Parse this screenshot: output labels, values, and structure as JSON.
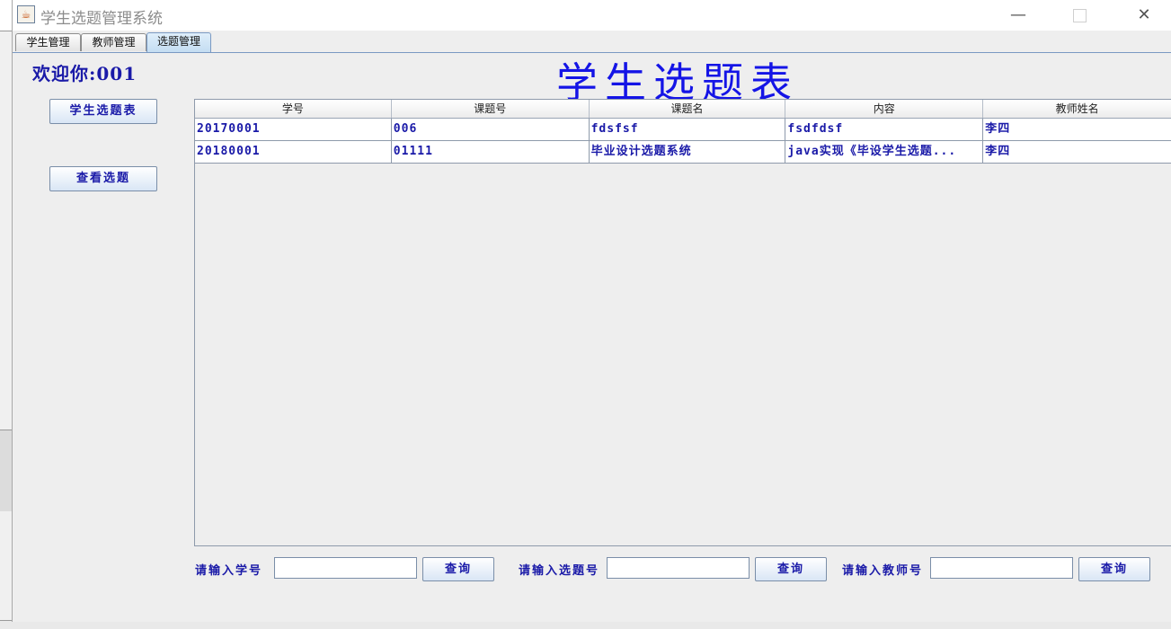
{
  "window": {
    "title": "学生选题管理系统"
  },
  "tabs": [
    {
      "label": "学生管理"
    },
    {
      "label": "教师管理"
    },
    {
      "label": "选题管理"
    }
  ],
  "active_tab": "选题管理",
  "welcome_text": "欢迎你:001",
  "page_title": "学生选题表",
  "sidebar": {
    "student_selection_button": "学生选题表",
    "view_topics_button": "查看选题"
  },
  "table": {
    "columns": [
      "学号",
      "课题号",
      "课题名",
      "内容",
      "教师姓名"
    ],
    "rows": [
      [
        "20170001",
        "006",
        "fdsfsf",
        "fsdfdsf",
        "李四"
      ],
      [
        "20180001",
        "01111",
        "毕业设计选题系统",
        "java实现《毕设学生选题...",
        "李四"
      ]
    ]
  },
  "search": {
    "student_id_label": "请输入学号",
    "topic_id_label": "请输入选题号",
    "teacher_id_label": "请输入教师号",
    "query_button": "查询",
    "student_id_value": "",
    "topic_id_value": "",
    "teacher_id_value": ""
  },
  "colors": {
    "accent_text": "#1a1aa8",
    "title_blue": "#1414e6",
    "window_bg": "#eeeeee"
  },
  "icons": {
    "app": "java-cup-icon",
    "minimize": "minimize-icon",
    "maximize": "maximize-icon",
    "close": "close-icon"
  }
}
